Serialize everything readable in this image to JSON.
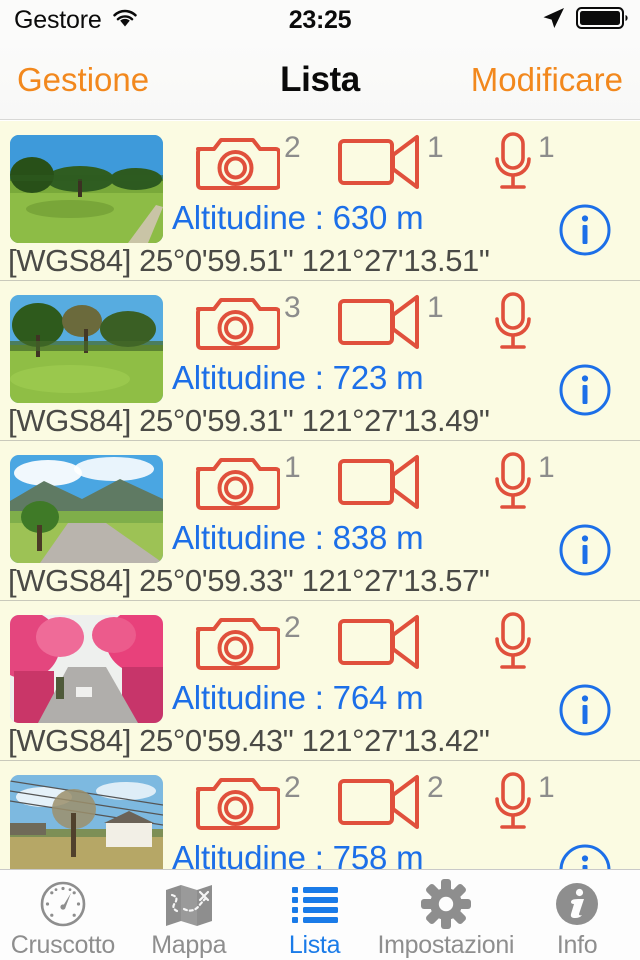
{
  "status_bar": {
    "carrier": "Gestore",
    "wifi_icon": "wifi-icon",
    "time": "23:25",
    "location_icon": "location-arrow-icon",
    "battery_icon": "battery-full-icon"
  },
  "nav_bar": {
    "back_label": "Gestione",
    "title": "Lista",
    "edit_label": "Modificare"
  },
  "colors": {
    "accent_orange": "#f2881d",
    "link_blue": "#1c6fe8",
    "tab_blue": "#1a7be8",
    "media_icon_red": "#e0503c",
    "count_gray": "#8c8c8c",
    "row_background": "#fbfbe2",
    "coord_text": "#4a4a46"
  },
  "list": {
    "altitude_label": "Altitudine",
    "altitude_unit": "m",
    "datum_label": "[WGS84]",
    "info_icon": "info-circle-icon",
    "photo_icon": "camera-icon",
    "video_icon": "video-camera-icon",
    "audio_icon": "microphone-icon",
    "rows": [
      {
        "photo_count": "2",
        "video_count": "1",
        "audio_count": "1",
        "altitude_text": "Altitudine : 630 m",
        "coords_text": "[WGS84] 25°0'59.51\" 121°27'13.51\"",
        "thumb_name": "thumbnail-park-meadow"
      },
      {
        "photo_count": "3",
        "video_count": "1",
        "audio_count": "",
        "altitude_text": "Altitudine : 723 m",
        "coords_text": "[WGS84] 25°0'59.31\" 121°27'13.49\"",
        "thumb_name": "thumbnail-grass-trees"
      },
      {
        "photo_count": "1",
        "video_count": "",
        "audio_count": "1",
        "altitude_text": "Altitudine : 838 m",
        "coords_text": "[WGS84] 25°0'59.33\" 121°27'13.57\"",
        "thumb_name": "thumbnail-mountain-road"
      },
      {
        "photo_count": "2",
        "video_count": "",
        "audio_count": "",
        "altitude_text": "Altitudine : 764 m",
        "coords_text": "[WGS84] 25°0'59.43\" 121°27'13.42\"",
        "thumb_name": "thumbnail-cherry-blossom-road"
      },
      {
        "photo_count": "2",
        "video_count": "2",
        "audio_count": "1",
        "altitude_text": "Altitudine : 758 m",
        "coords_text": "",
        "thumb_name": "thumbnail-bare-tree-house"
      }
    ]
  },
  "tab_bar": {
    "items": [
      {
        "label": "Cruscotto",
        "icon": "gauge-icon",
        "active": false
      },
      {
        "label": "Mappa",
        "icon": "map-icon",
        "active": false
      },
      {
        "label": "Lista",
        "icon": "list-icon",
        "active": true
      },
      {
        "label": "Impostazioni",
        "icon": "gear-icon",
        "active": false
      },
      {
        "label": "Info",
        "icon": "info-icon",
        "active": false
      }
    ]
  }
}
